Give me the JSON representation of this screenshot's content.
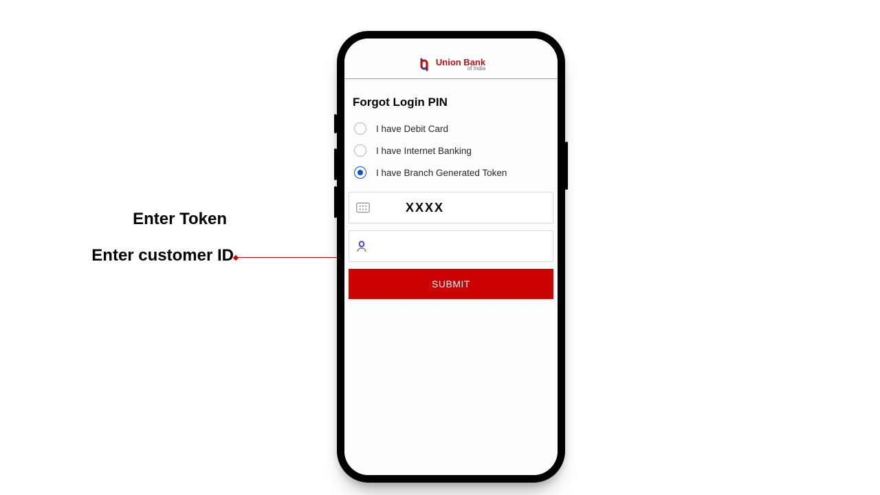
{
  "annotations": {
    "token_label": "Enter Token",
    "customer_id_label": "Enter customer ID"
  },
  "app": {
    "brand_main": "Union Bank",
    "brand_sub": "of India",
    "page_title": "Forgot Login PIN",
    "options": {
      "debit_card": {
        "label": "I have Debit Card",
        "selected": false
      },
      "internet_banking": {
        "label": "I have Internet Banking",
        "selected": false
      },
      "branch_token": {
        "label": "I have Branch Generated Token",
        "selected": true
      }
    },
    "token_input": {
      "value": "XXXX",
      "placeholder": ""
    },
    "customer_id_input": {
      "value": "",
      "placeholder": ""
    },
    "submit_label": "SUBMIT",
    "colors": {
      "brand_red": "#cc0303",
      "accent_blue": "#0a52d2"
    }
  }
}
